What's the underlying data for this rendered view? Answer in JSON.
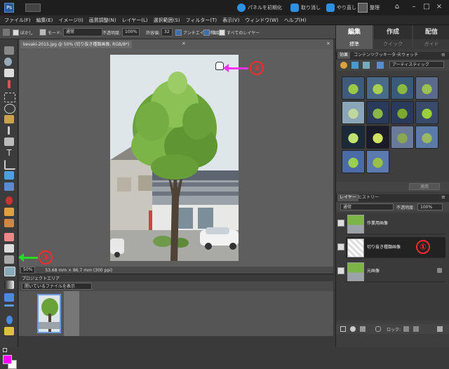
{
  "titlebar": {
    "reset_panels": "パネルを初期化",
    "undo": "取り消し",
    "redo": "やり直し",
    "organize": "整理"
  },
  "menu": [
    "ファイル(F)",
    "編集(E)",
    "イメージ(I)",
    "画質調整(N)",
    "レイヤー(L)",
    "選択範囲(S)",
    "フィルター(T)",
    "表示(V)",
    "ウィンドウ(W)",
    "ヘルプ(H)"
  ],
  "options": {
    "feather_label": "ぼかし",
    "mode_label": "モード:",
    "mode_value": "通常",
    "opacity_label": "不透明度:",
    "opacity_value": "100%",
    "tolerance_label": "許容値:",
    "tolerance_value": "32",
    "antialias": "アンチエイリアス",
    "contiguous": "隣接",
    "all_layers": "すべてのレイヤー"
  },
  "document": {
    "tab_title": "kevaki-2015.jpg @ 50% (切り抜き種類画像, RGB/8*)",
    "zoom": "50%",
    "dimensions": "53.68 mm × 86.7 mm (300 ppi)"
  },
  "project": {
    "title": "プロジェクトエリア",
    "filter": "開いているファイルを表示"
  },
  "right": {
    "tabs": [
      "編集",
      "作成",
      "配信"
    ],
    "subtabs": [
      "標準",
      "クイック",
      "ガイド"
    ],
    "effects_tabs": [
      "効果",
      "コンテンツ",
      "クッキーター",
      "スウォッチ"
    ],
    "artistic": "アーティスティック",
    "apply": "適用",
    "layer_tabs": [
      "レイヤー",
      "ヒストリー"
    ],
    "blend_mode": "通常",
    "opacity_label": "不透明度:",
    "opacity_value": "100%",
    "layers": [
      "作業用画像",
      "切り抜き種類画像",
      "元画像"
    ],
    "lock_label": "ロック:"
  },
  "annotations": [
    "①",
    "②",
    "③"
  ]
}
